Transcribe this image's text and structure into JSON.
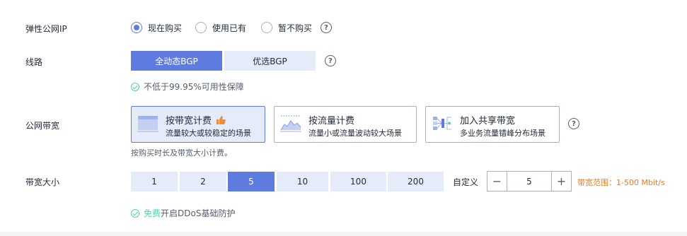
{
  "eip": {
    "label": "弹性公网IP",
    "options": [
      "现在购买",
      "使用已有",
      "暂不购买"
    ],
    "selected": "现在购买"
  },
  "route": {
    "label": "线路",
    "options": [
      "全动态BGP",
      "优选BGP"
    ],
    "selected": "全动态BGP",
    "note": "不低于99.95%可用性保障"
  },
  "bandwidth": {
    "label": "公网带宽",
    "cards": [
      {
        "title": "按带宽计费",
        "desc": "流量较大或较稳定的场景",
        "icon": "bandwidth-chart-icon"
      },
      {
        "title": "按流量计费",
        "desc": "流量小或流量波动较大场景",
        "icon": "traffic-chart-icon"
      },
      {
        "title": "加入共享带宽",
        "desc": "多业务流量错峰分布场景",
        "icon": "shared-bandwidth-icon"
      }
    ],
    "selected": "按带宽计费",
    "hint": "按购买时长及带宽大小计费。"
  },
  "size": {
    "label": "带宽大小",
    "options": [
      "1",
      "2",
      "5",
      "10",
      "100",
      "200"
    ],
    "selected": "5",
    "custom_label": "自定义",
    "custom_value": "5",
    "range": "带宽范围：1-500 Mbit/s",
    "range_color": "#e37d29"
  },
  "ddos": {
    "free": "免费",
    "text": "开启DDoS基础防护",
    "free_color": "#50d4ab"
  },
  "colors": {
    "accent": "#5e7ce0",
    "accent_light": "#e5ebf9",
    "success": "#50d4ab"
  }
}
